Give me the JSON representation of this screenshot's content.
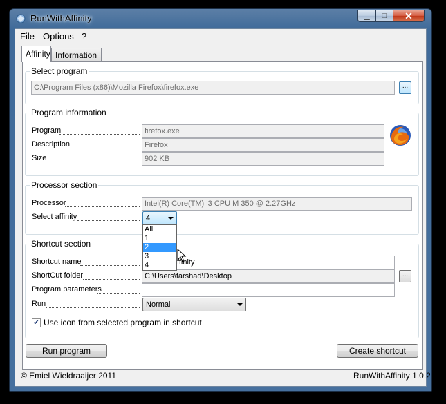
{
  "window": {
    "title": "RunWithAffinity",
    "minimize_glyph": "▁",
    "maximize_glyph": "□",
    "close_glyph": "✕"
  },
  "menu": [
    "File",
    "Options",
    "?"
  ],
  "tabs": [
    {
      "label": "Affinity",
      "active": true
    },
    {
      "label": "Information",
      "active": false
    }
  ],
  "select_program": {
    "legend": "Select program",
    "path": "C:\\Program Files (x86)\\Mozilla Firefox\\firefox.exe",
    "browse": "..."
  },
  "program_info": {
    "legend": "Program information",
    "program_label": "Program",
    "program_value": "firefox.exe",
    "description_label": "Description",
    "description_value": "Firefox",
    "size_label": "Size",
    "size_value": "902 KB",
    "icon": "firefox-logo"
  },
  "processor": {
    "legend": "Processor section",
    "processor_label": "Processor",
    "processor_value": "Intel(R) Core(TM) i3 CPU M 350 @ 2.27GHz",
    "affinity_label": "Select affinity",
    "affinity_value": "4",
    "options": [
      "All",
      "1",
      "2",
      "3",
      "4"
    ],
    "highlighted_option": "2"
  },
  "shortcut": {
    "legend": "Shortcut section",
    "name_label": "Shortcut name",
    "name_value": "ffinity",
    "folder_label": "ShortCut folder",
    "folder_value": "C:\\Users\\farshad\\Desktop",
    "folder_browse": "...",
    "params_label": "Program parameters",
    "params_value": "",
    "run_label": "Run",
    "run_value": "Normal",
    "checkbox_label": "Use icon from selected program in shortcut",
    "checkbox_checked": true
  },
  "buttons": {
    "run": "Run program",
    "create": "Create shortcut"
  },
  "footer": {
    "copyright": "© Emiel Wieldraaijer 2011",
    "version": "RunWithAffinity 1.0.2"
  }
}
